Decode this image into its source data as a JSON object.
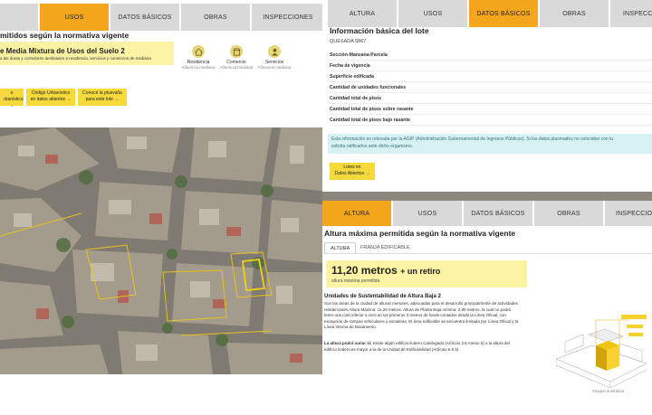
{
  "left": {
    "tabs": [
      "",
      "USOS",
      "DATOS BÁSICOS",
      "OBRAS",
      "INSPECCIONES"
    ],
    "heading": "mitidos según la normativa vigente",
    "zone": {
      "title": "e Media Mixtura de Usos del Suelo 2",
      "desc": "a las áreas y corredores destinados a residencia, servicios y comercios de mediana"
    },
    "icons": [
      {
        "name": "residencia-icon",
        "label": "Residencia",
        "sub": "Afluencia mediana"
      },
      {
        "name": "comercio-icon",
        "label": "Comercio",
        "sub": "Afluencia mediana"
      },
      {
        "name": "servicios-icon",
        "label": "Servicios",
        "sub": "Afluencia mediana"
      }
    ],
    "buttons": [
      {
        "line1": "o",
        "line2": "rbanístico →"
      },
      {
        "line1": "Código Urbanístico",
        "line2": "en datos abiertos →"
      },
      {
        "line1": "Conocé la plusvalía",
        "line2": "para este lote →"
      }
    ]
  },
  "rtop": {
    "tabs": [
      "ALTURA",
      "USOS",
      "DATOS BÁSICOS",
      "OBRAS",
      "INSPECCIO"
    ],
    "heading": "Información básica del lote",
    "address": "QUESADA 5867",
    "rows": [
      "Sección-Manzana-Parcela",
      "Fecha de vigencia",
      "Superficie edificada",
      "Cantidad de unidades funcionales",
      "Cantidad total de pisos",
      "Cantidad total de pisos sobre rasante",
      "Cantidad total de pisos bajo rasante"
    ],
    "notice_1": "Esta información es relevada por la AGIP (Administración Gubernamental de Ingresos Públicos). Si los datos plasmados no coinciden con tu",
    "notice_2": "solicita ratificarlos ante dicho organismo.",
    "lot_button": {
      "line1": "Lotes en",
      "line2": "Datos Abiertos →"
    }
  },
  "rbot": {
    "tabs": [
      "ALTURA",
      "USOS",
      "DATOS BÁSICOS",
      "OBRAS",
      "INSPECCIONE"
    ],
    "heading": "Altura máxima permitida según la normativa vigente",
    "subtabs": [
      "ALTURA",
      "FRANJA EDIFICABLE"
    ],
    "height_value": "11,20 metros",
    "height_suffix": "+ un retiro",
    "height_caption": "altura máxima permitida",
    "usab_title": "Unidades de Sustentabilidad de Altura Baja 2",
    "usab_text": [
      "Son las áreas de la ciudad de alturas menores, adecuadas para el desarrollo principalmente de actividades",
      "residenciales.Altura Máxima: 11,20 metros. Altura de Planta Baja mínima: 2,80 metros, la cual no podrá",
      "tener una cota inferior a cero en los primeros 3 metros de fondo contados desde la Línea Oficial, con",
      "excepción de rampas vehiculares y escaleras. El área edificable se encuentra limitada por Línea Oficial y la",
      "Línea Interna de Basamento."
    ],
    "note_bold": "La altura podrá variar si:",
    "note_text_1": "existe algún edificio lindero Catalogado (Artículo 3.6 Anexo II) o la altura del",
    "note_text_2": "edificio lindero es mayor a la de la Unidad de Edificabilidad (Artículo 6.5.5).",
    "illustration_caption": "Imagen ilustrativa"
  },
  "colors": {
    "accent": "#f4a71d",
    "tab_bg": "#d9d9d9",
    "yellow_box": "#fcf4a4",
    "button": "#f6d93b",
    "notice_bg": "#d8f1f4"
  }
}
